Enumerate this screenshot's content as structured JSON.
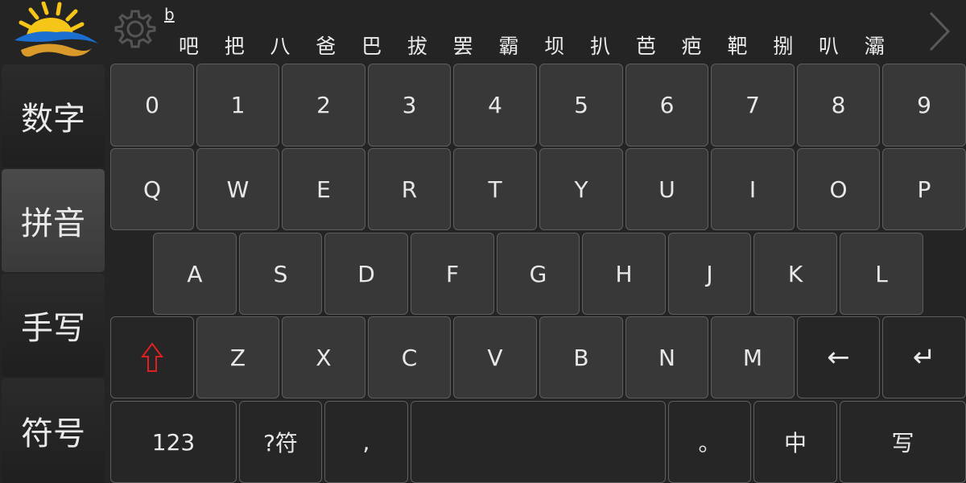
{
  "candidate_bar": {
    "pinyin": "b",
    "candidates": [
      "吧",
      "把",
      "八",
      "爸",
      "巴",
      "拔",
      "罢",
      "霸",
      "坝",
      "扒",
      "芭",
      "疤",
      "靶",
      "捌",
      "叭",
      "灞"
    ]
  },
  "modes": [
    {
      "label": "数字",
      "active": false
    },
    {
      "label": "拼音",
      "active": true
    },
    {
      "label": "手写",
      "active": false
    },
    {
      "label": "符号",
      "active": false
    }
  ],
  "keys": {
    "row1": [
      "0",
      "1",
      "2",
      "3",
      "4",
      "5",
      "6",
      "7",
      "8",
      "9"
    ],
    "row2": [
      "Q",
      "W",
      "E",
      "R",
      "T",
      "Y",
      "U",
      "I",
      "O",
      "P"
    ],
    "row3": [
      "A",
      "S",
      "D",
      "F",
      "G",
      "H",
      "J",
      "K",
      "L"
    ],
    "row4": {
      "shift": "⇧",
      "letters": [
        "Z",
        "X",
        "C",
        "V",
        "B",
        "N",
        "M"
      ],
      "backspace": "←",
      "enter": "↵"
    },
    "row5": {
      "numbers": "123",
      "symbols": "?符",
      "comma": ",",
      "space": "",
      "period": "。",
      "chinese": "中",
      "handwrite": "写"
    }
  },
  "colors": {
    "background": "#242424",
    "key": "#383838",
    "key_border": "#5e5e5e",
    "shift_arrow": "#e02020",
    "logo_sun": "#f5c518",
    "logo_wave": "#1a6fd0"
  },
  "icons": {
    "settings": "gear-icon",
    "next_page": "chevron-right-icon",
    "shift": "shift-arrow-icon"
  }
}
